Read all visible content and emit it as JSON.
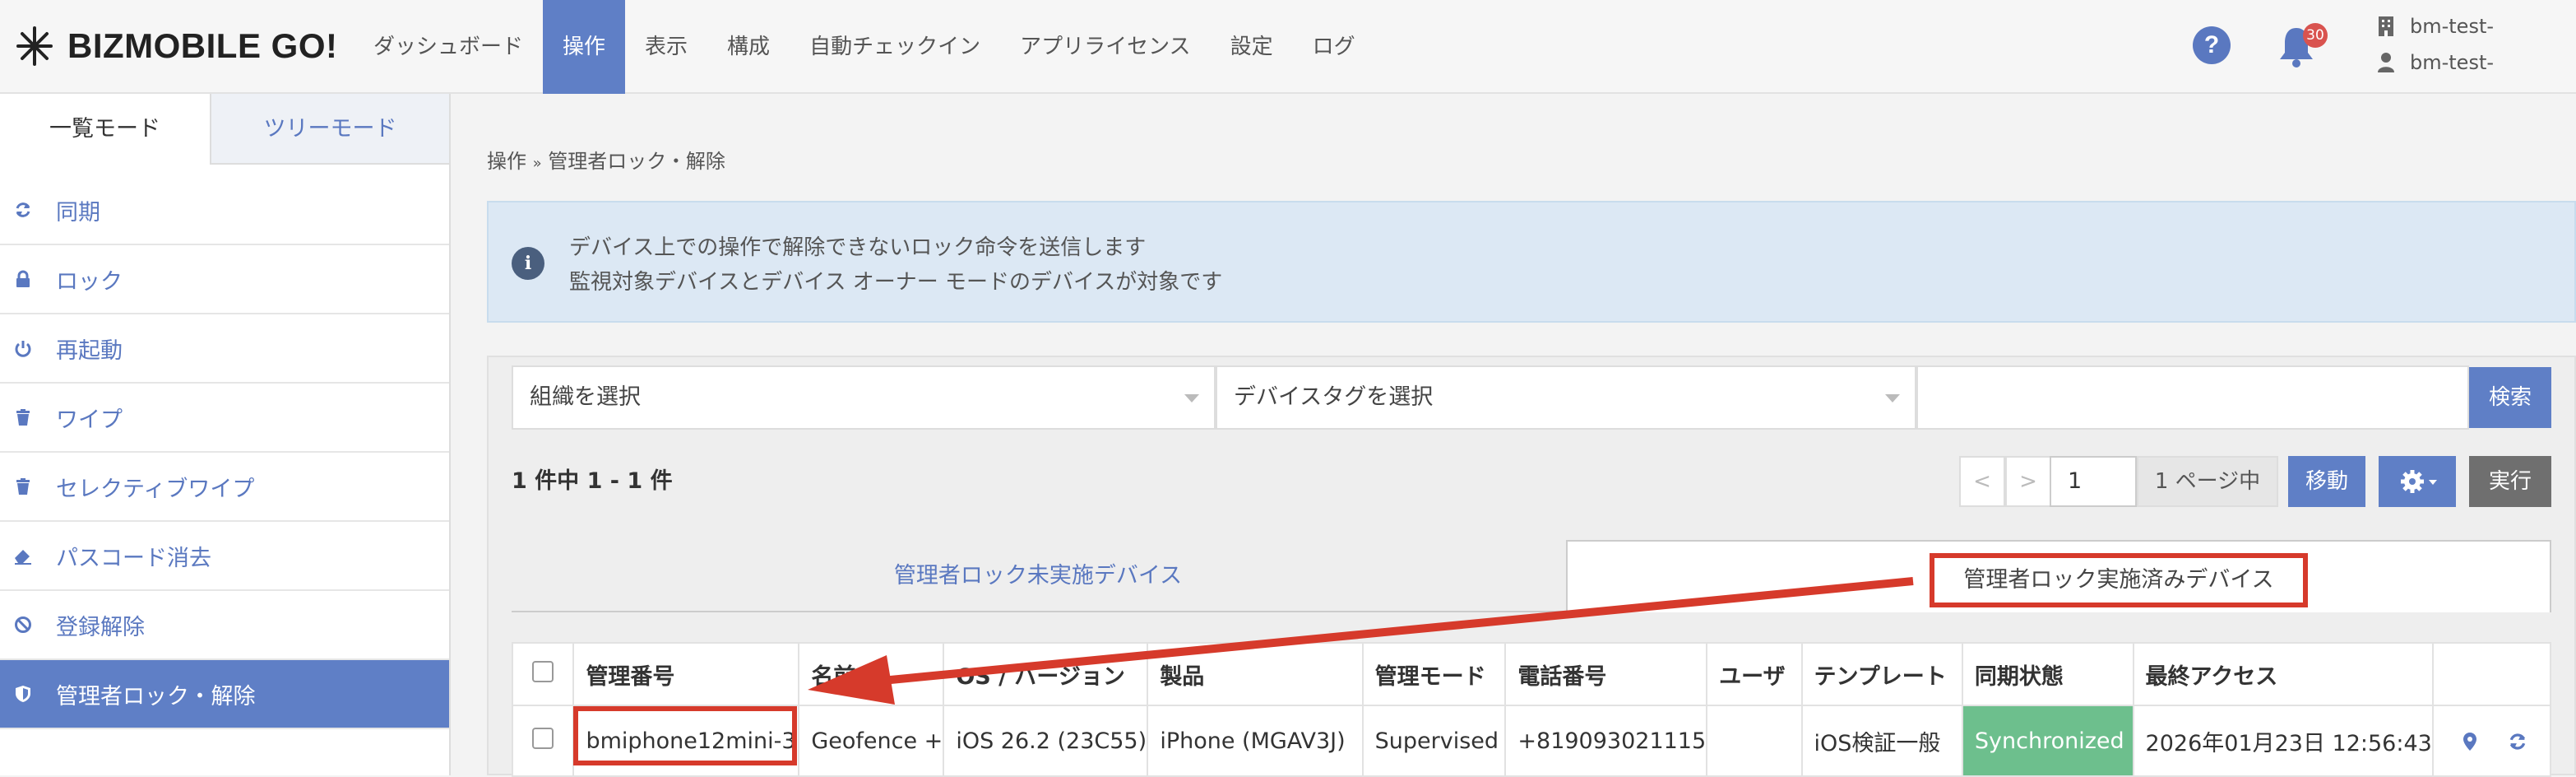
{
  "header": {
    "logo_text": "BIZMOBILE GO!",
    "nav": [
      "ダッシュボード",
      "操作",
      "表示",
      "構成",
      "自動チェックイン",
      "アプリライセンス",
      "設定",
      "ログ"
    ],
    "active_nav": "操作",
    "help_label": "?",
    "notification_count": "30",
    "org_name": "bm-test-",
    "user_name": "bm-test-"
  },
  "sidebar": {
    "tabs": [
      "一覧モード",
      "ツリーモード"
    ],
    "items": [
      {
        "label": "同期",
        "icon": "sync-icon"
      },
      {
        "label": "ロック",
        "icon": "lock-icon"
      },
      {
        "label": "再起動",
        "icon": "power-icon"
      },
      {
        "label": "ワイプ",
        "icon": "trash-icon"
      },
      {
        "label": "セレクティブワイプ",
        "icon": "trash-icon"
      },
      {
        "label": "パスコード消去",
        "icon": "eraser-icon"
      },
      {
        "label": "登録解除",
        "icon": "ban-icon"
      },
      {
        "label": "管理者ロック・解除",
        "icon": "shield-icon"
      }
    ]
  },
  "main": {
    "breadcrumb": {
      "parent": "操作",
      "separator": "»",
      "current": "管理者ロック・解除"
    },
    "info_icon": "i",
    "info_line1": "デバイス上での操作で解除できないロック命令を送信します",
    "info_line2": "監視対象デバイスとデバイス オーナー モードのデバイスが対象です",
    "org_select": "組織を選択",
    "tag_select": "デバイスタグを選択",
    "search_value": "",
    "search_button": "検索",
    "result_count": "1 件中 1 - 1 件",
    "prev": "<",
    "next": ">",
    "page": "1",
    "page_total": "1 ページ中",
    "move_button": "移動",
    "run_button": "実行",
    "subtabs": [
      "管理者ロック未実施デバイス",
      "管理者ロック実施済みデバイス"
    ],
    "table": {
      "headers": [
        "管理番号",
        "名前",
        "OS / バージョン",
        "製品",
        "管理モード",
        "電話番号",
        "ユーザ",
        "テンプレート",
        "同期状態",
        "最終アクセス"
      ],
      "rows": [
        [
          "bmiphone12mini-3",
          "Geofence +",
          "iOS 26.2 (23C55)",
          "iPhone (MGAV3J)",
          "Supervised",
          "+819093021115",
          "",
          "iOS検証一般",
          "Synchronized",
          "2026年01月23日 12:56:43"
        ]
      ]
    }
  },
  "colors": {
    "accent": "#5f7fc6",
    "annotation_red": "#d63a2b",
    "sync_green": "#6dbf8d"
  }
}
